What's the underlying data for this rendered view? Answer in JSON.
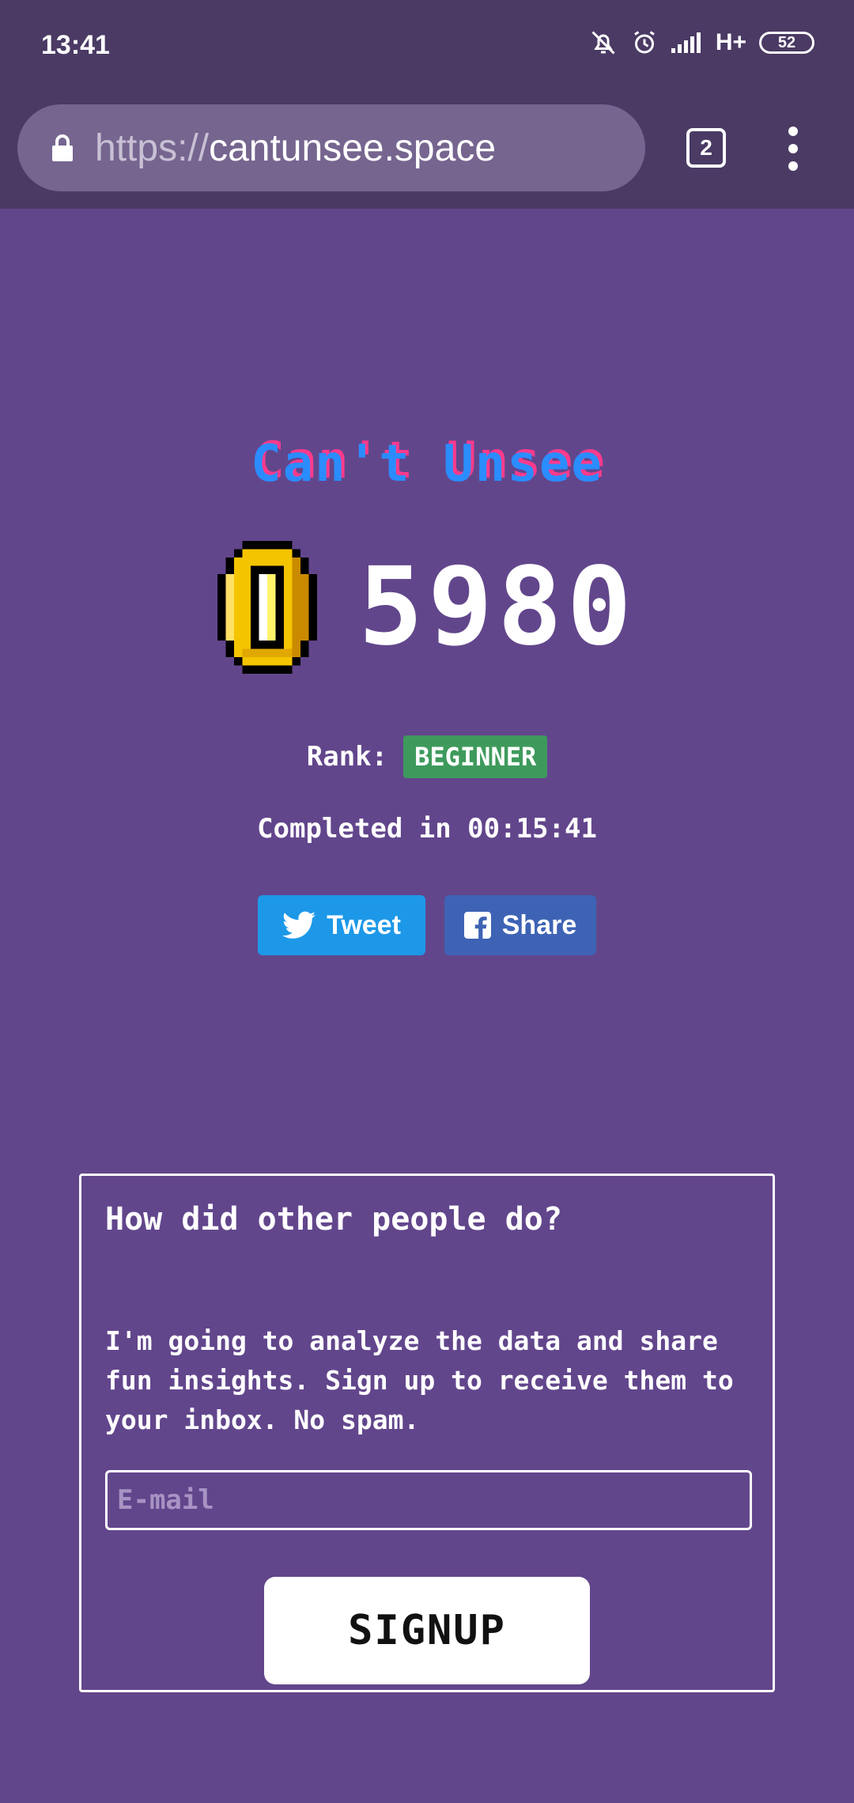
{
  "status_bar": {
    "time": "13:41",
    "network": "H+",
    "battery": "52",
    "icons": [
      "mute-icon",
      "alarm-icon",
      "signal-icon",
      "battery-icon"
    ]
  },
  "browser": {
    "url_scheme": "https://",
    "url_host": "cantunsee.space",
    "tab_count": "2"
  },
  "game": {
    "title": "Can't Unsee",
    "score": "5980",
    "rank_label": "Rank:",
    "rank_value": "BEGINNER",
    "completed_text": "Completed in 00:15:41"
  },
  "share": {
    "tweet_label": "Tweet",
    "share_label": "Share"
  },
  "signup": {
    "heading": "How did other people do?",
    "body": "I'm going to analyze the data and share fun insights. Sign up to receive them to your inbox. No spam.",
    "email_placeholder": "E-mail",
    "email_value": "",
    "button_label": "SIGNUP"
  },
  "colors": {
    "page_background": "#62468c",
    "browser_chrome": "#4a3a64",
    "title_blue": "#2b8cff",
    "title_pink": "#ff3a8c",
    "rank_green": "#3e9a5c",
    "twitter_blue": "#1d98e8",
    "facebook_blue": "#3e63b5"
  }
}
